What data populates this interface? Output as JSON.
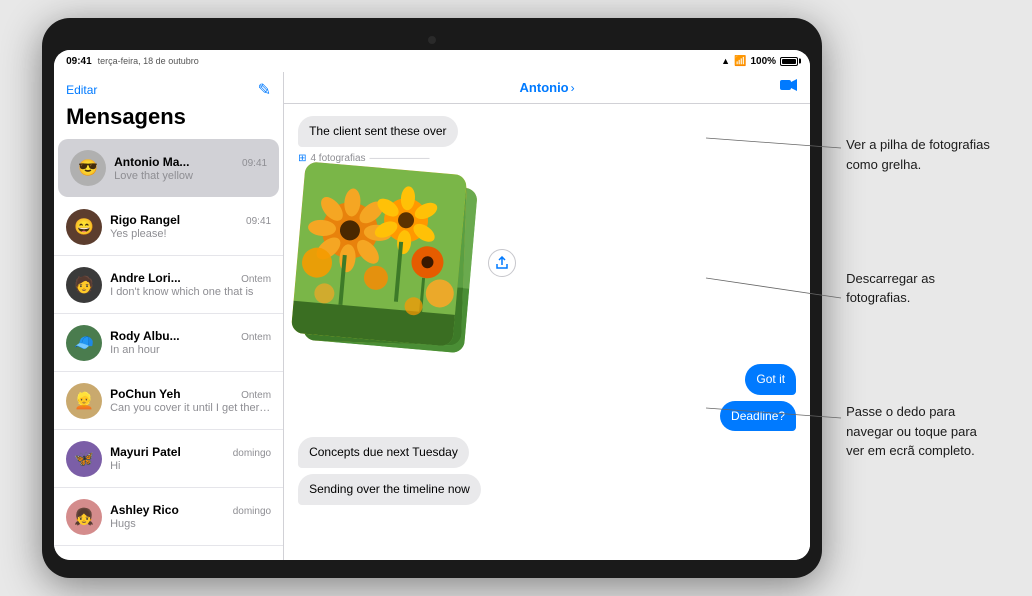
{
  "statusBar": {
    "time": "09:41",
    "date": "terça-feira, 18 de outubro",
    "signal": "▲",
    "wifi": "wifi",
    "battery": "100%"
  },
  "sidebar": {
    "editLabel": "Editar",
    "title": "Mensagens",
    "contacts": [
      {
        "id": 1,
        "name": "Antonio Ma...",
        "time": "09:41",
        "preview": "Love that yellow",
        "avatar": "😎",
        "avatarBg": "#b0b0b0",
        "active": true
      },
      {
        "id": 2,
        "name": "Rigo Rangel",
        "time": "09:41",
        "preview": "Yes please!",
        "avatar": "😄",
        "avatarBg": "#5c3d2e"
      },
      {
        "id": 3,
        "name": "Andre Lori...",
        "time": "Ontem",
        "preview": "I don't know which one that is",
        "avatar": "🧑",
        "avatarBg": "#3a3a3a"
      },
      {
        "id": 4,
        "name": "Rody Albu...",
        "time": "Ontem",
        "preview": "In an hour",
        "avatar": "🟢",
        "avatarBg": "#4a7c4e"
      },
      {
        "id": 5,
        "name": "PoChun Yeh",
        "time": "Ontem",
        "preview": "Can you cover it until I get there?",
        "avatar": "👱",
        "avatarBg": "#c9a96e"
      },
      {
        "id": 6,
        "name": "Mayuri Patel",
        "time": "domingo",
        "preview": "Hi",
        "avatar": "🦋",
        "avatarBg": "#7b5ea7"
      },
      {
        "id": 7,
        "name": "Ashley Rico",
        "time": "domingo",
        "preview": "Hugs",
        "avatar": "👧",
        "avatarBg": "#d48c8c"
      }
    ]
  },
  "chat": {
    "contactName": "Antonio",
    "messages": [
      {
        "id": 1,
        "text": "The client sent these over",
        "type": "incoming"
      },
      {
        "id": 2,
        "type": "photo-stack",
        "label": "4 fotografias"
      },
      {
        "id": 3,
        "text": "Got it",
        "type": "outgoing"
      },
      {
        "id": 4,
        "text": "Deadline?",
        "type": "outgoing"
      },
      {
        "id": 5,
        "text": "Concepts due next Tuesday",
        "type": "incoming"
      },
      {
        "id": 6,
        "text": "Sending over the timeline now",
        "type": "incoming"
      }
    ]
  },
  "annotations": {
    "annotation1": "Ver a pilha de fotografias\ncomo grelha.",
    "annotation2": "Descarregar as\nfotografias.",
    "annotation3": "Passe o dedo para\nnavegar ou toque para\nver em ecrã completo."
  }
}
